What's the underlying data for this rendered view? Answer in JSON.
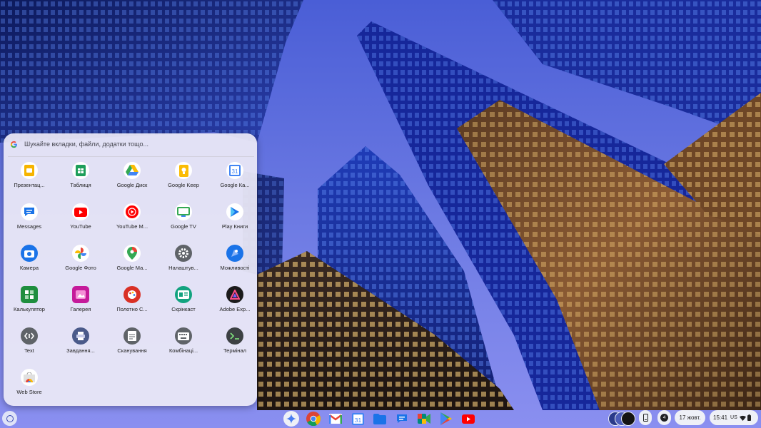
{
  "launcher": {
    "search_placeholder": "Шукайте вкладки, файли, додатки тощо...",
    "apps": [
      {
        "label": "Презентац...",
        "icon": "google-slides-icon",
        "color": "#f6b400"
      },
      {
        "label": "Таблиця",
        "icon": "google-sheets-icon",
        "color": "#1e9e5a"
      },
      {
        "label": "Google Диск",
        "icon": "google-drive-icon",
        "color": "#1a73e8"
      },
      {
        "label": "Google Keep",
        "icon": "google-keep-icon",
        "color": "#fbbc04"
      },
      {
        "label": "Google Ка...",
        "icon": "google-calendar-icon",
        "color": "#4285f4"
      },
      {
        "label": "Messages",
        "icon": "messages-icon",
        "color": "#1a73e8"
      },
      {
        "label": "YouTube",
        "icon": "youtube-icon",
        "color": "#ff0000"
      },
      {
        "label": "YouTube M...",
        "icon": "youtube-music-icon",
        "color": "#ff0000"
      },
      {
        "label": "Google TV",
        "icon": "google-tv-icon",
        "color": "#34a853"
      },
      {
        "label": "Play Книги",
        "icon": "play-books-icon",
        "color": "#1a73e8"
      },
      {
        "label": "Камера",
        "icon": "camera-icon",
        "color": "#1a73e8"
      },
      {
        "label": "Google Фото",
        "icon": "google-photos-icon",
        "color": "#ea4335"
      },
      {
        "label": "Google Ма...",
        "icon": "google-maps-icon",
        "color": "#34a853"
      },
      {
        "label": "Налаштув...",
        "icon": "settings-icon",
        "color": "#5f6368"
      },
      {
        "label": "Можливості",
        "icon": "explore-icon",
        "color": "#1a73e8"
      },
      {
        "label": "Калькулятор",
        "icon": "calculator-icon",
        "color": "#1e8e3e"
      },
      {
        "label": "Галерея",
        "icon": "gallery-icon",
        "color": "#c51a9a"
      },
      {
        "label": "Полотно С...",
        "icon": "canvas-icon",
        "color": "#d93025"
      },
      {
        "label": "Скрінкаст",
        "icon": "screencast-icon",
        "color": "#12a37f"
      },
      {
        "label": "Adobe Exp...",
        "icon": "adobe-express-icon",
        "color": "#1b1b1b"
      },
      {
        "label": "Text",
        "icon": "text-editor-icon",
        "color": "#5f6368"
      },
      {
        "label": "Завдання...",
        "icon": "print-jobs-icon",
        "color": "#4a5a8a"
      },
      {
        "label": "Сканування",
        "icon": "scan-icon",
        "color": "#5f6368"
      },
      {
        "label": "Комбінаці...",
        "icon": "keyboard-shortcuts-icon",
        "color": "#5f6368"
      },
      {
        "label": "Термінал",
        "icon": "terminal-icon",
        "color": "#3c4043"
      },
      {
        "label": "Web Store",
        "icon": "web-store-icon",
        "color": "#ea4335"
      }
    ]
  },
  "shelf": {
    "pinned": [
      {
        "icon": "gemini-icon"
      },
      {
        "icon": "chrome-icon"
      },
      {
        "icon": "gmail-icon"
      },
      {
        "icon": "google-calendar-icon"
      },
      {
        "icon": "files-icon"
      },
      {
        "icon": "messages-icon"
      },
      {
        "icon": "google-meet-icon"
      },
      {
        "icon": "play-store-icon"
      },
      {
        "icon": "youtube-icon"
      }
    ],
    "notification_count": "4",
    "date": "17 жовт.",
    "time": "15:41",
    "input_method": "US"
  }
}
